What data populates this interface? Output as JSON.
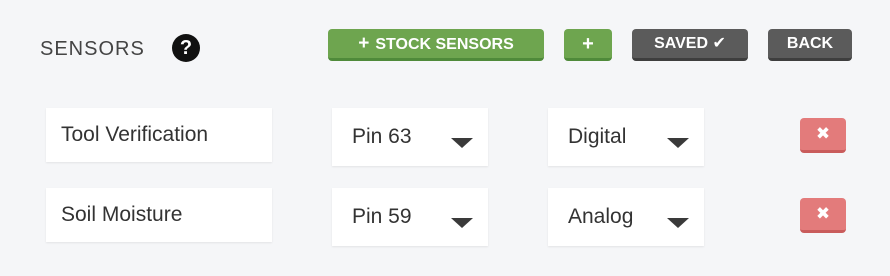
{
  "header": {
    "title": "SENSORS",
    "help_icon": "?",
    "stock_sensors_label": "STOCK SENSORS",
    "add_symbol": "+",
    "saved_label": "SAVED ✔",
    "back_label": "BACK"
  },
  "colors": {
    "green": "#6ea54f",
    "gray": "#5b5b5b",
    "red": "#e37b7b"
  },
  "sensors": [
    {
      "name": "Tool Verification",
      "pin": "Pin 63",
      "mode": "Digital",
      "delete_symbol": "✖"
    },
    {
      "name": "Soil Moisture",
      "pin": "Pin 59",
      "mode": "Analog",
      "delete_symbol": "✖"
    }
  ]
}
